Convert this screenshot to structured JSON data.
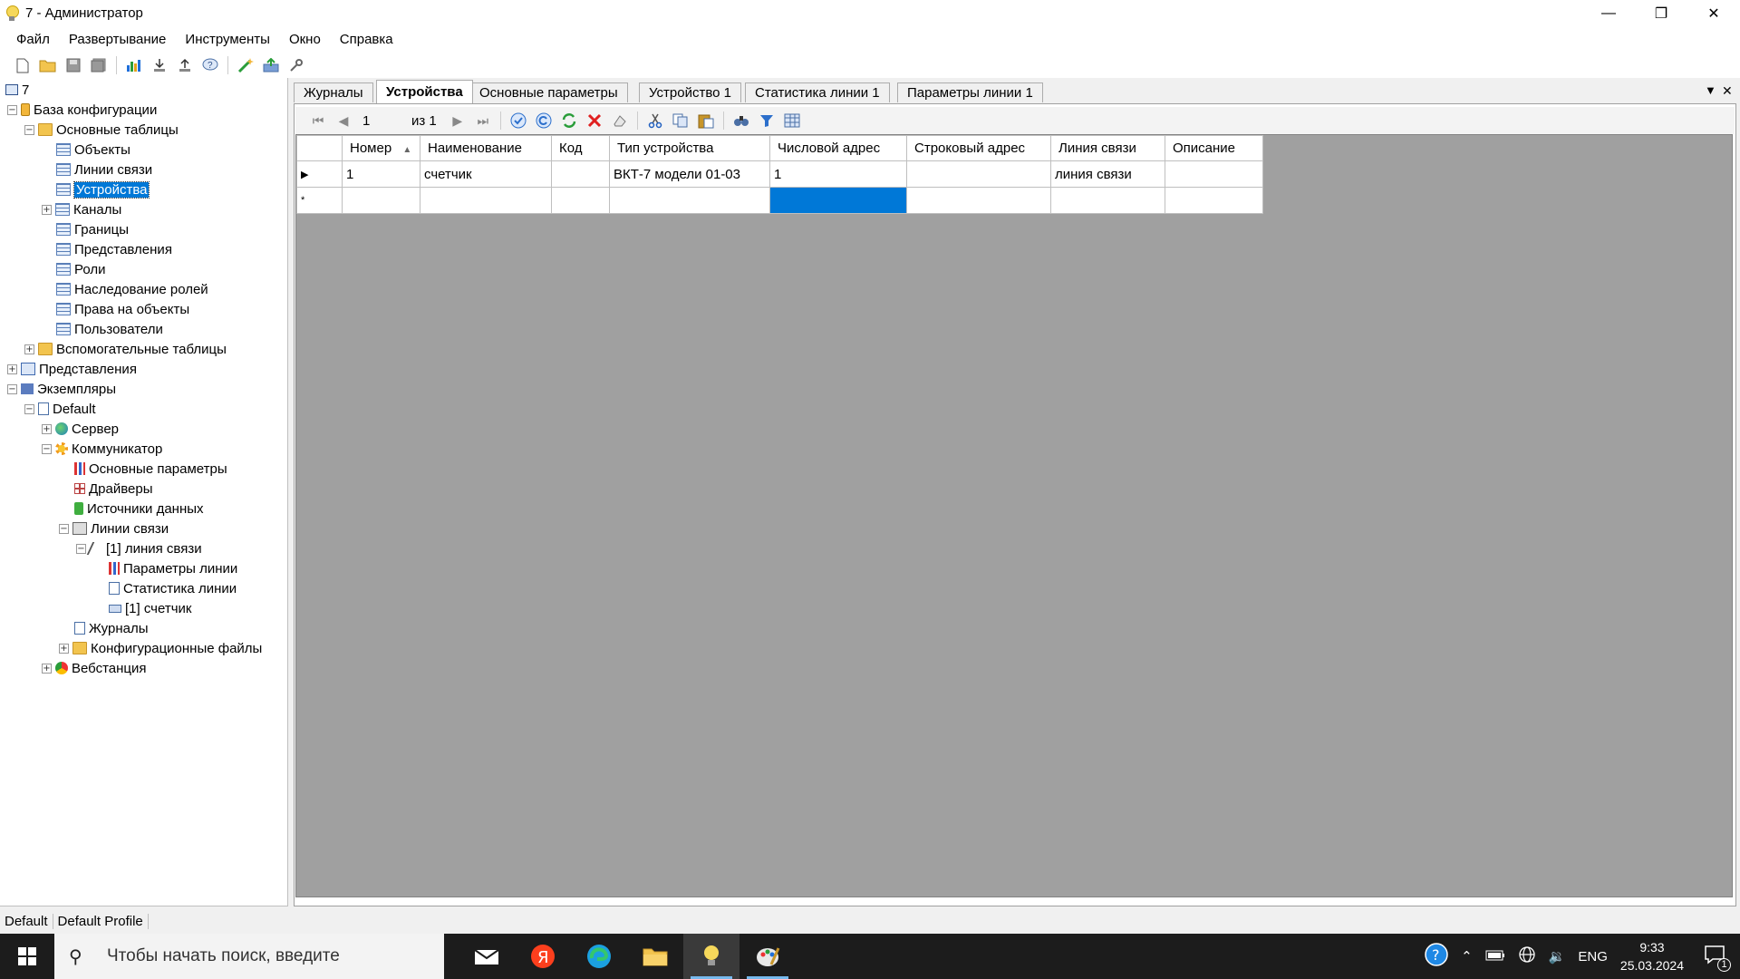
{
  "window": {
    "title": "7 - Администратор"
  },
  "menu": [
    "Файл",
    "Развертывание",
    "Инструменты",
    "Окно",
    "Справка"
  ],
  "tree": {
    "root": "7",
    "nodes": [
      {
        "label": "База конфигурации",
        "icon": "database-icon"
      },
      {
        "label": "Основные таблицы",
        "icon": "folder-open-icon"
      },
      {
        "label": "Объекты",
        "icon": "table-icon"
      },
      {
        "label": "Линии связи",
        "icon": "table-icon"
      },
      {
        "label": "Устройства",
        "icon": "table-icon"
      },
      {
        "label": "Каналы",
        "icon": "table-icon"
      },
      {
        "label": "Границы",
        "icon": "table-icon"
      },
      {
        "label": "Представления",
        "icon": "table-icon"
      },
      {
        "label": "Роли",
        "icon": "table-icon"
      },
      {
        "label": "Наследование ролей",
        "icon": "table-icon"
      },
      {
        "label": "Права на объекты",
        "icon": "table-icon"
      },
      {
        "label": "Пользователи",
        "icon": "table-icon"
      },
      {
        "label": "Вспомогательные таблицы",
        "icon": "folder-icon"
      },
      {
        "label": "Представления",
        "icon": "views-icon"
      },
      {
        "label": "Экземпляры",
        "icon": "instances-icon"
      },
      {
        "label": "Default",
        "icon": "instance-icon"
      },
      {
        "label": "Сервер",
        "icon": "server-icon"
      },
      {
        "label": "Коммуникатор",
        "icon": "communicator-icon"
      },
      {
        "label": "Основные параметры",
        "icon": "params-icon"
      },
      {
        "label": "Драйверы",
        "icon": "drivers-icon"
      },
      {
        "label": "Источники данных",
        "icon": "data-sources-icon"
      },
      {
        "label": "Линии связи",
        "icon": "comm-lines-icon"
      },
      {
        "label": "[1] линия связи",
        "icon": "comm-line-icon"
      },
      {
        "label": "Параметры линии",
        "icon": "params-icon"
      },
      {
        "label": "Статистика линии",
        "icon": "document-icon"
      },
      {
        "label": "[1] счетчик",
        "icon": "device-icon"
      },
      {
        "label": "Журналы",
        "icon": "document-icon"
      },
      {
        "label": "Конфигурационные файлы",
        "icon": "folder-icon"
      },
      {
        "label": "Вебстанция",
        "icon": "webstation-icon"
      }
    ]
  },
  "tabs": [
    "Журналы",
    "Устройства",
    "Основные параметры",
    "Устройство 1",
    "Статистика линии 1",
    "Параметры линии 1"
  ],
  "active_tab": "Устройства",
  "navigator": {
    "position": "1",
    "count_label": "из 1"
  },
  "grid": {
    "columns": [
      "Номер",
      "Наименование",
      "Код",
      "Тип устройства",
      "Числовой адрес",
      "Строковый адрес",
      "Линия связи",
      "Описание"
    ],
    "rows": [
      {
        "marker": "▶",
        "cells": [
          "1",
          "счетчик",
          "",
          "ВКТ-7 модели 01-03",
          "1",
          "",
          "линия связи",
          ""
        ]
      },
      {
        "marker": "*",
        "cells": [
          "",
          "",
          "",
          "",
          "",
          "",
          "",
          ""
        ]
      }
    ]
  },
  "status": {
    "instance": "Default",
    "profile": "Default Profile"
  },
  "taskbar": {
    "search_placeholder": "Чтобы начать поиск, введите",
    "lang": "ENG",
    "time": "9:33",
    "date": "25.03.2024",
    "notifications": "1"
  },
  "colors": {
    "selection": "#0078d7",
    "grid_background": "#a0a0a0",
    "taskbar": "#1c1c1c"
  }
}
